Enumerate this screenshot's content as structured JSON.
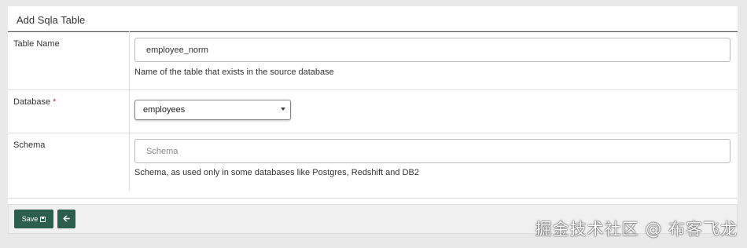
{
  "panel": {
    "title": "Add Sqla Table"
  },
  "fields": {
    "table_name": {
      "label": "Table Name",
      "value": "employee_norm",
      "help": "Name of the table that exists in the source database"
    },
    "database": {
      "label": "Database",
      "required_marker": "*",
      "selected": "employees"
    },
    "schema": {
      "label": "Schema",
      "placeholder": "Schema",
      "help": "Schema, as used only in some databases like Postgres, Redshift and DB2"
    }
  },
  "actions": {
    "save_label": "Save",
    "save_icon": "floppy-disk-icon",
    "back_icon": "arrow-left-icon"
  },
  "watermark": "掘金技术社区 @ 布客飞龙",
  "colors": {
    "button": "#2b5e4c",
    "background": "#e9e9e9",
    "required": "#c0392b"
  }
}
